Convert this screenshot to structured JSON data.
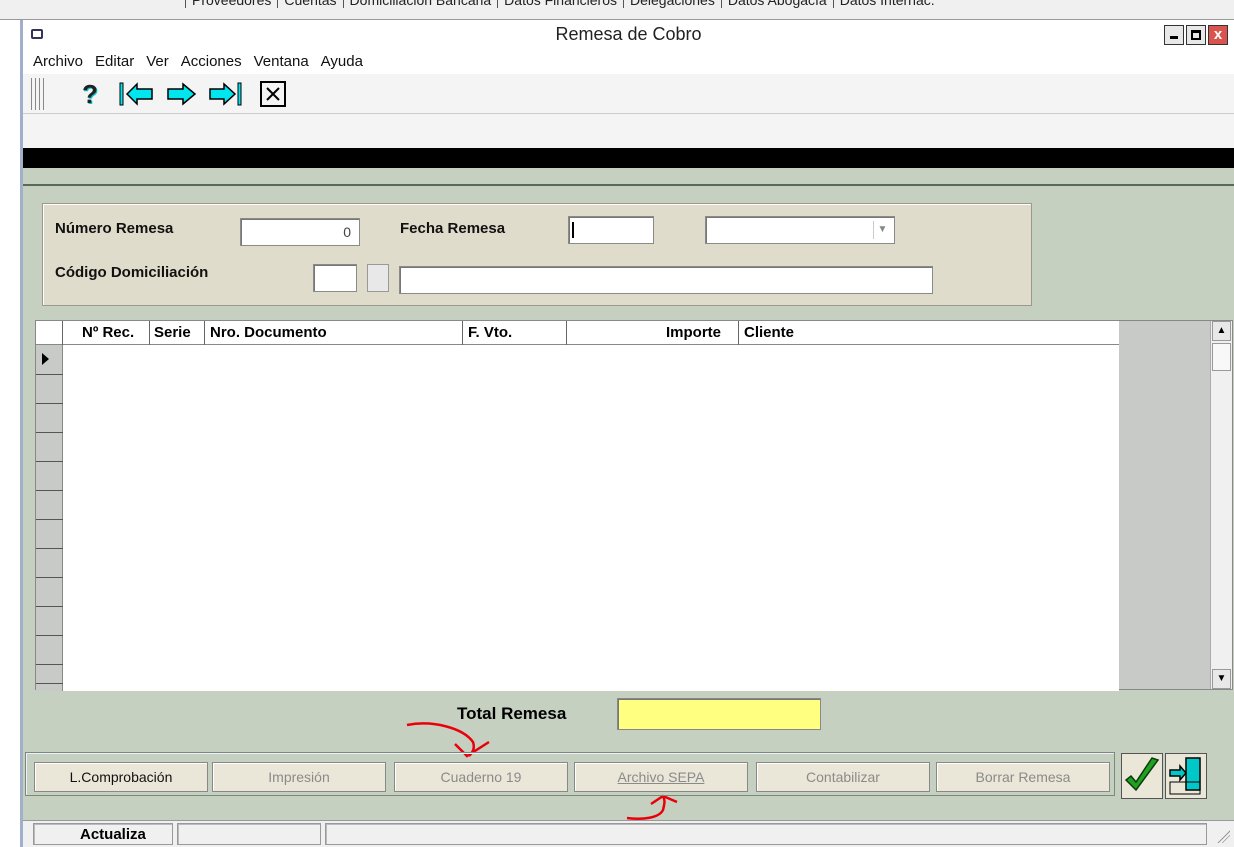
{
  "background_window": {
    "tabs": [
      "Proveedores",
      "Cuentas",
      "Domiciliación Bancaria",
      "Datos Financieros",
      "Delegaciones",
      "Datos Abogacía",
      "Datos Internac."
    ]
  },
  "window": {
    "title": "Remesa de Cobro",
    "controls": {
      "close_label": "x"
    }
  },
  "menu": [
    "Archivo",
    "Editar",
    "Ver",
    "Acciones",
    "Ventana",
    "Ayuda"
  ],
  "toolbar": {
    "icons": [
      "help-icon",
      "first-record-icon",
      "next-record-icon",
      "last-record-icon",
      "close-form-icon"
    ],
    "help_glyph": "?"
  },
  "form": {
    "numero_remesa_label": "Número Remesa",
    "numero_remesa_value": "0",
    "fecha_remesa_label": "Fecha Remesa",
    "fecha_remesa_value": "",
    "codigo_domiciliacion_label": "Código Domiciliación",
    "codigo_value": "",
    "codigo_desc_value": ""
  },
  "grid": {
    "columns": [
      "Nº Rec.",
      "Serie",
      "Nro. Documento",
      "F. Vto.",
      "Importe",
      "Cliente"
    ],
    "rows": []
  },
  "total": {
    "label": "Total Remesa",
    "value": ""
  },
  "buttons": {
    "comprobacion": "L.Comprobación",
    "impresion": "Impresión",
    "cuaderno19": "Cuaderno 19",
    "archivo_sepa": "Archivo SEPA",
    "contabilizar": "Contabilizar",
    "borrar_remesa": "Borrar Remesa",
    "accept_icon": "checkmark-icon",
    "exit_icon": "exit-door-icon"
  },
  "status": {
    "mode": "Actualiza",
    "cell2": "",
    "cell3": ""
  },
  "colors": {
    "total_field": "#ffff80",
    "annotation": "#e8000b",
    "toolbar_icon": "#00e5ee"
  }
}
